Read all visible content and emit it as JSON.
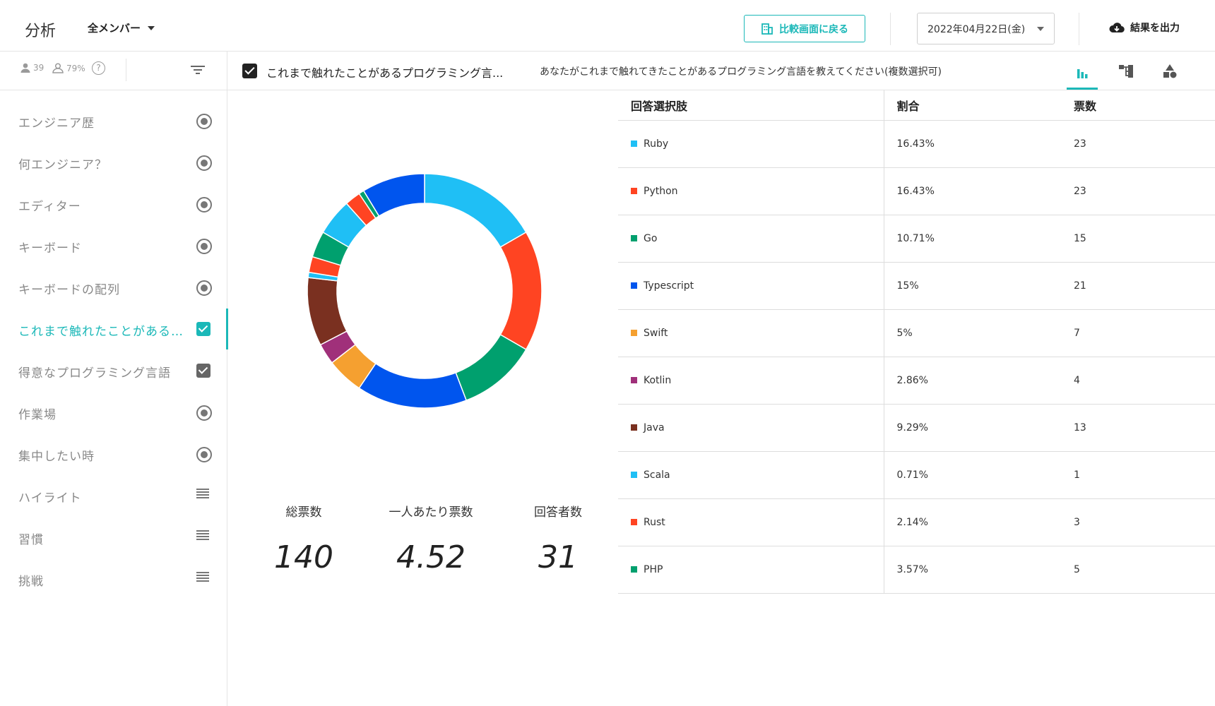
{
  "app": {
    "title": "分析"
  },
  "header": {
    "member_filter": "全メンバー",
    "compare_button": "比較画面に戻る",
    "date": "2022年04月22日(金)",
    "export_button": "結果を出力"
  },
  "sidebar": {
    "member_count": "39",
    "response_rate": "79%",
    "items": [
      {
        "label": "エンジニア歴",
        "icon": "radio-icon"
      },
      {
        "label": "何エンジニア？",
        "icon": "radio-icon"
      },
      {
        "label": "エディター",
        "icon": "radio-icon"
      },
      {
        "label": "キーボード",
        "icon": "radio-icon"
      },
      {
        "label": "キーボードの配列",
        "icon": "radio-icon"
      },
      {
        "label": "これまで触れたことがある…",
        "icon": "checkbox-icon",
        "active": true
      },
      {
        "label": "得意なプログラミング言語",
        "icon": "checkbox-icon"
      },
      {
        "label": "作業場",
        "icon": "radio-icon"
      },
      {
        "label": "集中したい時",
        "icon": "radio-icon"
      },
      {
        "label": "ハイライト",
        "icon": "text-lines-icon"
      },
      {
        "label": "習慣",
        "icon": "text-lines-icon"
      },
      {
        "label": "挑戦",
        "icon": "text-lines-icon"
      }
    ]
  },
  "question": {
    "title": "これまで触れたことがあるプログラミング言...",
    "description": "あなたがこれまで触れてきたことがあるプログラミング言語を教えてください(複数選択可)"
  },
  "stats": {
    "total_votes_label": "総票数",
    "total_votes": "140",
    "per_person_label": "一人あたり票数",
    "per_person": "4.52",
    "respondents_label": "回答者数",
    "respondents": "31"
  },
  "table": {
    "headers": [
      "回答選択肢",
      "割合",
      "票数"
    ],
    "rows": [
      {
        "name": "Ruby",
        "pct": "16.43%",
        "votes": "23",
        "color": "#1fbff5"
      },
      {
        "name": "Python",
        "pct": "16.43%",
        "votes": "23",
        "color": "#ff4422"
      },
      {
        "name": "Go",
        "pct": "10.71%",
        "votes": "15",
        "color": "#00a06e"
      },
      {
        "name": "Typescript",
        "pct": "15%",
        "votes": "21",
        "color": "#0055ee"
      },
      {
        "name": "Swift",
        "pct": "5%",
        "votes": "7",
        "color": "#f5a030"
      },
      {
        "name": "Kotlin",
        "pct": "2.86%",
        "votes": "4",
        "color": "#a0307a"
      },
      {
        "name": "Java",
        "pct": "9.29%",
        "votes": "13",
        "color": "#7a3020"
      },
      {
        "name": "Scala",
        "pct": "0.71%",
        "votes": "1",
        "color": "#1fbff5"
      },
      {
        "name": "Rust",
        "pct": "2.14%",
        "votes": "3",
        "color": "#ff4422"
      },
      {
        "name": "PHP",
        "pct": "3.57%",
        "votes": "5",
        "color": "#00a06e"
      }
    ]
  },
  "chart_data": {
    "type": "pie",
    "donut": true,
    "categories": [
      "Ruby",
      "Python",
      "Go",
      "Typescript",
      "Swift",
      "Kotlin",
      "Java",
      "Scala",
      "Rust",
      "PHP",
      "Swift",
      "Rust",
      "Go",
      "Typescript"
    ],
    "values": [
      23,
      23,
      15,
      21,
      7,
      4,
      13,
      1,
      3,
      5,
      7,
      3,
      1,
      12
    ],
    "colors": [
      "#1fbff5",
      "#ff4422",
      "#00a06e",
      "#0055ee",
      "#f5a030",
      "#a0307a",
      "#7a3020",
      "#1fbff5",
      "#ff4422",
      "#00a06e",
      "#1fbff5",
      "#ff4422",
      "#00a06e",
      "#0055ee"
    ]
  }
}
